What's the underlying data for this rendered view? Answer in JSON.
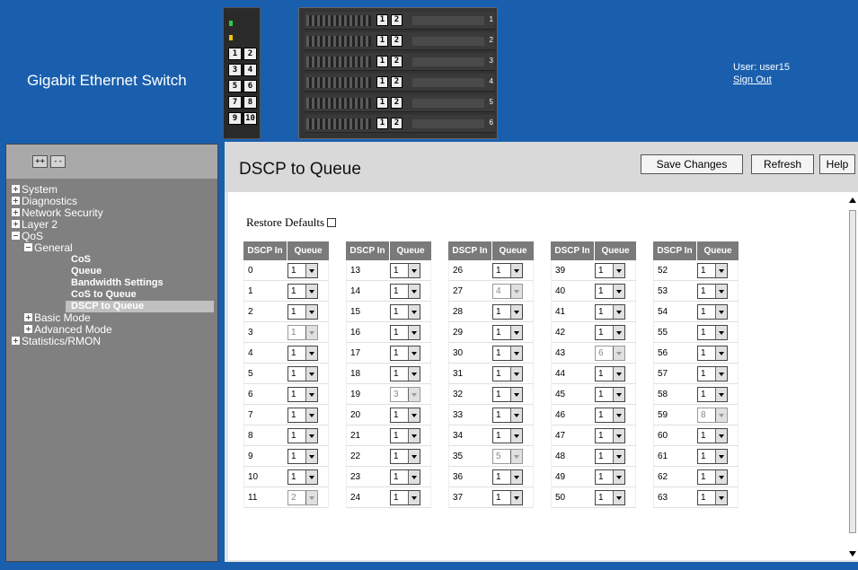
{
  "header": {
    "title": "Gigabit Ethernet Switch",
    "user_label": "User: user15",
    "sign_out": "Sign Out",
    "left_unit_ports": [
      "1",
      "2",
      "3",
      "4",
      "5",
      "6",
      "7",
      "8",
      "9",
      "10"
    ],
    "blades": [
      {
        "ports": [
          "1",
          "2"
        ],
        "slot": "1"
      },
      {
        "ports": [
          "1",
          "2"
        ],
        "slot": "2"
      },
      {
        "ports": [
          "1",
          "2"
        ],
        "slot": "3"
      },
      {
        "ports": [
          "1",
          "2"
        ],
        "slot": "4"
      },
      {
        "ports": [
          "1",
          "2"
        ],
        "slot": "5"
      },
      {
        "ports": [
          "1",
          "2"
        ],
        "slot": "6"
      }
    ]
  },
  "sidebar": {
    "expand_all": "++",
    "collapse_all": "--",
    "tree": [
      {
        "label": "System",
        "type": "node",
        "state": "plus",
        "indent": 0
      },
      {
        "label": "Diagnostics",
        "type": "node",
        "state": "plus",
        "indent": 0
      },
      {
        "label": "Network Security",
        "type": "node",
        "state": "plus",
        "indent": 0
      },
      {
        "label": "Layer 2",
        "type": "node",
        "state": "plus",
        "indent": 0
      },
      {
        "label": "QoS",
        "type": "node",
        "state": "minus",
        "indent": 0
      },
      {
        "label": "General",
        "type": "node",
        "state": "minus",
        "indent": 1
      },
      {
        "label": "CoS",
        "type": "leaf",
        "indent": 2
      },
      {
        "label": "Queue",
        "type": "leaf",
        "indent": 2
      },
      {
        "label": "Bandwidth Settings",
        "type": "leaf",
        "indent": 2
      },
      {
        "label": "CoS to Queue",
        "type": "leaf",
        "indent": 2
      },
      {
        "label": "DSCP to Queue",
        "type": "leaf",
        "indent": 2,
        "selected": true
      },
      {
        "label": "Basic Mode",
        "type": "node",
        "state": "plus",
        "indent": 1
      },
      {
        "label": "Advanced Mode",
        "type": "node",
        "state": "plus",
        "indent": 1
      },
      {
        "label": "Statistics/RMON",
        "type": "node",
        "state": "plus",
        "indent": 0
      }
    ]
  },
  "main": {
    "page_title": "DSCP to Queue",
    "buttons": {
      "save": "Save Changes",
      "refresh": "Refresh",
      "help": "Help"
    },
    "restore_defaults": "Restore Defaults",
    "col_dscp": "DSCP In",
    "col_queue": "Queue",
    "tables": [
      {
        "rows": [
          [
            "0",
            "1",
            false
          ],
          [
            "1",
            "1",
            false
          ],
          [
            "2",
            "1",
            false
          ],
          [
            "3",
            "1",
            true
          ],
          [
            "4",
            "1",
            false
          ],
          [
            "5",
            "1",
            false
          ],
          [
            "6",
            "1",
            false
          ],
          [
            "7",
            "1",
            false
          ],
          [
            "8",
            "1",
            false
          ],
          [
            "9",
            "1",
            false
          ],
          [
            "10",
            "1",
            false
          ],
          [
            "11",
            "2",
            true
          ]
        ]
      },
      {
        "rows": [
          [
            "13",
            "1",
            false
          ],
          [
            "14",
            "1",
            false
          ],
          [
            "15",
            "1",
            false
          ],
          [
            "16",
            "1",
            false
          ],
          [
            "17",
            "1",
            false
          ],
          [
            "18",
            "1",
            false
          ],
          [
            "19",
            "3",
            true
          ],
          [
            "20",
            "1",
            false
          ],
          [
            "21",
            "1",
            false
          ],
          [
            "22",
            "1",
            false
          ],
          [
            "23",
            "1",
            false
          ],
          [
            "24",
            "1",
            false
          ]
        ]
      },
      {
        "rows": [
          [
            "26",
            "1",
            false
          ],
          [
            "27",
            "4",
            true
          ],
          [
            "28",
            "1",
            false
          ],
          [
            "29",
            "1",
            false
          ],
          [
            "30",
            "1",
            false
          ],
          [
            "31",
            "1",
            false
          ],
          [
            "32",
            "1",
            false
          ],
          [
            "33",
            "1",
            false
          ],
          [
            "34",
            "1",
            false
          ],
          [
            "35",
            "5",
            true
          ],
          [
            "36",
            "1",
            false
          ],
          [
            "37",
            "1",
            false
          ]
        ]
      },
      {
        "rows": [
          [
            "39",
            "1",
            false
          ],
          [
            "40",
            "1",
            false
          ],
          [
            "41",
            "1",
            false
          ],
          [
            "42",
            "1",
            false
          ],
          [
            "43",
            "6",
            true
          ],
          [
            "44",
            "1",
            false
          ],
          [
            "45",
            "1",
            false
          ],
          [
            "46",
            "1",
            false
          ],
          [
            "47",
            "1",
            false
          ],
          [
            "48",
            "1",
            false
          ],
          [
            "49",
            "1",
            false
          ],
          [
            "50",
            "1",
            false
          ]
        ]
      },
      {
        "rows": [
          [
            "52",
            "1",
            false
          ],
          [
            "53",
            "1",
            false
          ],
          [
            "54",
            "1",
            false
          ],
          [
            "55",
            "1",
            false
          ],
          [
            "56",
            "1",
            false
          ],
          [
            "57",
            "1",
            false
          ],
          [
            "58",
            "1",
            false
          ],
          [
            "59",
            "8",
            true
          ],
          [
            "60",
            "1",
            false
          ],
          [
            "61",
            "1",
            false
          ],
          [
            "62",
            "1",
            false
          ],
          [
            "63",
            "1",
            false
          ]
        ]
      }
    ]
  },
  "colors": {
    "header_bg": "#1a5fae",
    "sidebar_bg": "#808080",
    "table_header": "#7a7a7a"
  }
}
